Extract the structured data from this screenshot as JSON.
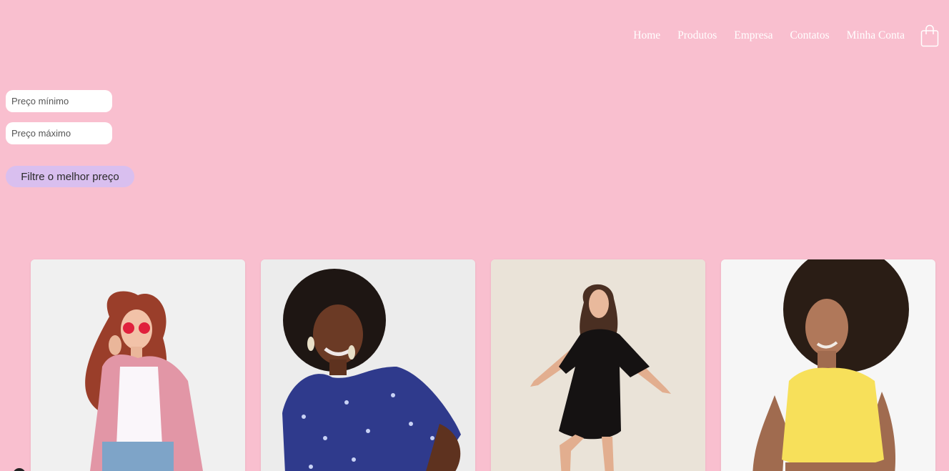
{
  "nav": {
    "items": [
      {
        "label": "Home"
      },
      {
        "label": "Produtos"
      },
      {
        "label": "Empresa"
      },
      {
        "label": "Contatos"
      },
      {
        "label": "Minha Conta"
      }
    ],
    "cart_icon": "shopping-bag-icon"
  },
  "filter": {
    "min_placeholder": "Preço mínimo",
    "max_placeholder": "Preço máximo",
    "min_value": "",
    "max_value": "",
    "button_label": "Filtre o melhor preço"
  },
  "products": [
    {
      "image": "woman in pink blazer and red heart glasses"
    },
    {
      "image": "smiling woman in blue floral blouse"
    },
    {
      "image": "woman dancing in black dress"
    },
    {
      "image": "woman in yellow sleeveless crop top"
    }
  ],
  "colors": {
    "background": "#f9bfcf",
    "nav_text": "#ffffff",
    "button_bg": "#d9bfef",
    "input_bg": "#ffffff"
  }
}
